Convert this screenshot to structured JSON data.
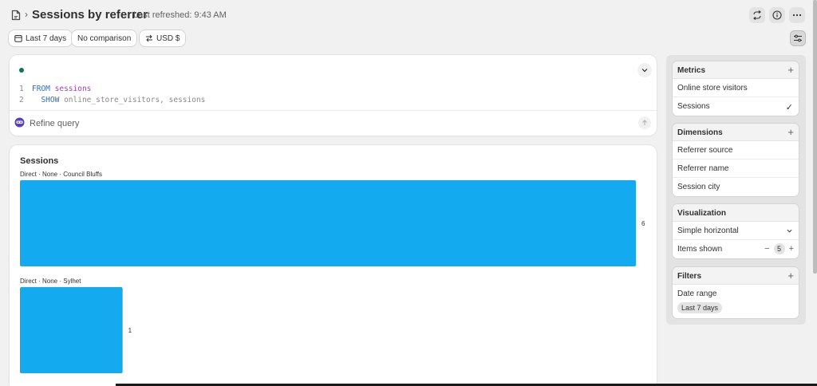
{
  "header": {
    "breadcrumb_separator": "›",
    "title": "Sessions by referrer",
    "last_refreshed": "Last refreshed: 9:43 AM",
    "icons": [
      "document-icon",
      "repeat-icon",
      "info-icon",
      "more-icon"
    ]
  },
  "filters": {
    "date_range": "Last 7 days",
    "comparison": "No comparison",
    "currency": "USD $"
  },
  "query": {
    "status_color": "#0a7a4a",
    "lines": [
      {
        "num": "1",
        "keyword": "FROM",
        "rest": "sessions"
      },
      {
        "num": "2",
        "keyword": "SHOW",
        "rest": "online_store_visitors, sessions"
      }
    ],
    "refine_placeholder": "Refine query"
  },
  "chart_data": {
    "type": "bar",
    "orientation": "horizontal",
    "title": "Sessions",
    "categories": [
      "Direct · None · Council Bluffs",
      "Direct · None · Sylhet"
    ],
    "values": [
      6,
      1
    ],
    "max_value": 6,
    "bar_color": "#13aaf0",
    "data_labels": [
      "6",
      "1"
    ]
  },
  "side": {
    "metrics": {
      "title": "Metrics",
      "add": "+",
      "items": [
        {
          "label": "Online store visitors",
          "selected": false
        },
        {
          "label": "Sessions",
          "selected": true
        }
      ],
      "check": "✓"
    },
    "dimensions": {
      "title": "Dimensions",
      "add": "+",
      "items": [
        "Referrer source",
        "Referrer name",
        "Session city"
      ]
    },
    "visualization": {
      "title": "Visualization",
      "type_value": "Simple horizontal",
      "items_label": "Items shown",
      "items_value": "5",
      "minus": "−",
      "plus": "+"
    },
    "filters": {
      "title": "Filters",
      "add": "+",
      "date_label": "Date range",
      "date_chip": "Last 7 days"
    }
  }
}
